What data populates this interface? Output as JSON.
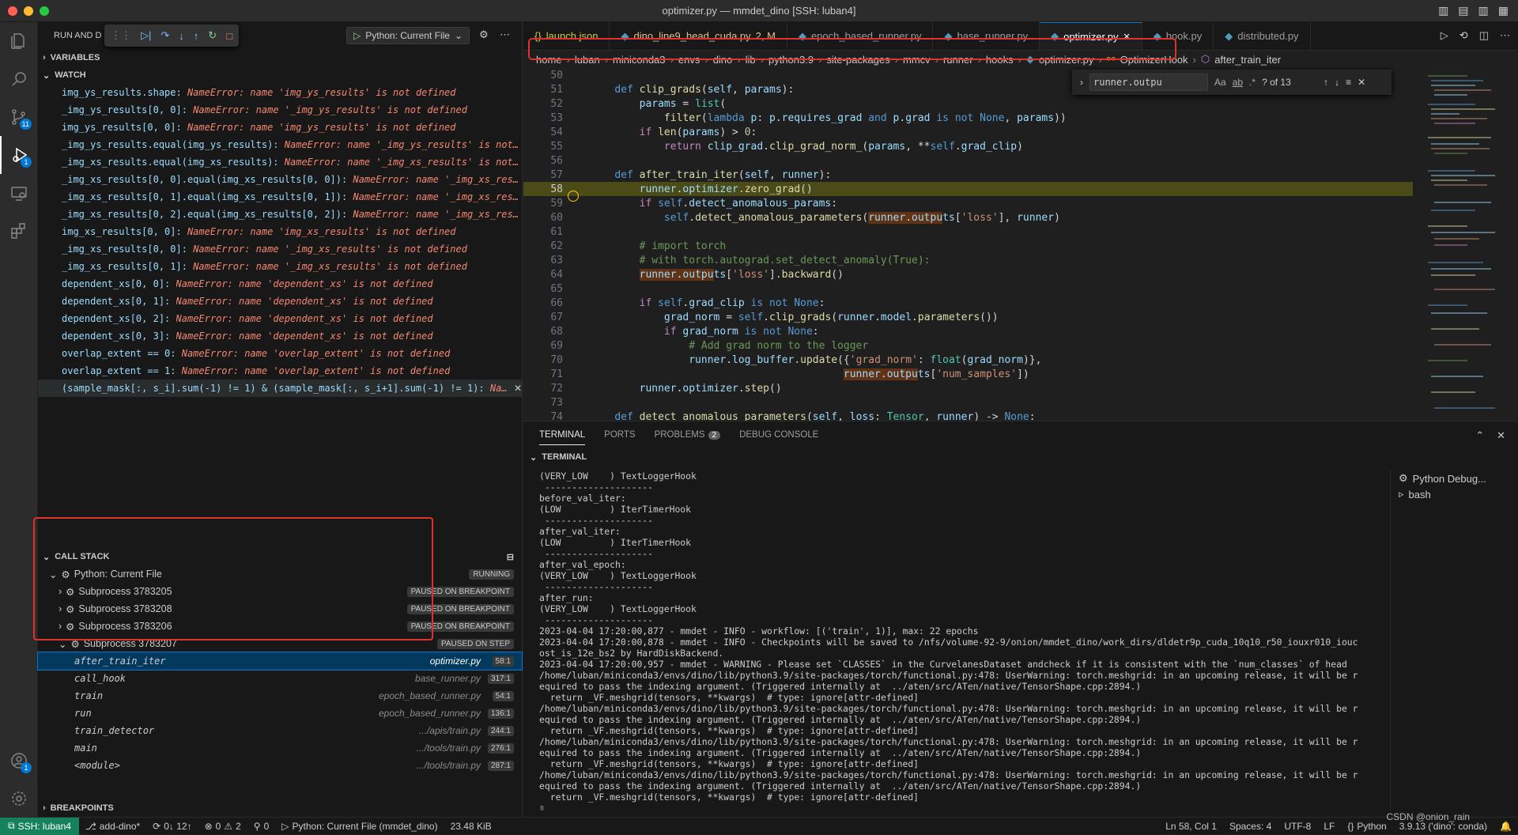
{
  "window": {
    "title": "optimizer.py — mmdet_dino [SSH: luban4]"
  },
  "activity_bar": {
    "badge_scm": "11",
    "badge_debug": "1",
    "badge_account": "1"
  },
  "run_panel": {
    "header": "RUN AND D",
    "config_label": "Python: Current File",
    "variables_label": "VARIABLES",
    "watch_label": "WATCH",
    "watch": [
      {
        "expr": "img_ys_results.shape:",
        "val": "NameError: name 'img_ys_results' is not defined"
      },
      {
        "expr": "_img_ys_results[0, 0]:",
        "val": "NameError: name '_img_ys_results' is not defined"
      },
      {
        "expr": "img_ys_results[0, 0]:",
        "val": "NameError: name 'img_ys_results' is not defined"
      },
      {
        "expr": "_img_ys_results.equal(img_ys_results):",
        "val": "NameError: name '_img_ys_results' is not defined"
      },
      {
        "expr": "_img_xs_results.equal(img_xs_results):",
        "val": "NameError: name '_img_xs_results' is not defined"
      },
      {
        "expr": "_img_xs_results[0, 0].equal(img_xs_results[0, 0]):",
        "val": "NameError: name '_img_xs_results' is..."
      },
      {
        "expr": "_img_xs_results[0, 1].equal(img_xs_results[0, 1]):",
        "val": "NameError: name '_img_xs_results' is..."
      },
      {
        "expr": "_img_xs_results[0, 2].equal(img_xs_results[0, 2]):",
        "val": "NameError: name '_img_xs_results' is..."
      },
      {
        "expr": "img_xs_results[0, 0]:",
        "val": "NameError: name 'img_xs_results' is not defined"
      },
      {
        "expr": "_img_xs_results[0, 0]:",
        "val": "NameError: name '_img_xs_results' is not defined"
      },
      {
        "expr": "_img_xs_results[0, 1]:",
        "val": "NameError: name '_img_xs_results' is not defined"
      },
      {
        "expr": "dependent_xs[0, 0]:",
        "val": "NameError: name 'dependent_xs' is not defined"
      },
      {
        "expr": "dependent_xs[0, 1]:",
        "val": "NameError: name 'dependent_xs' is not defined"
      },
      {
        "expr": "dependent_xs[0, 2]:",
        "val": "NameError: name 'dependent_xs' is not defined"
      },
      {
        "expr": "dependent_xs[0, 3]:",
        "val": "NameError: name 'dependent_xs' is not defined"
      },
      {
        "expr": "overlap_extent == 0:",
        "val": "NameError: name 'overlap_extent' is not defined"
      },
      {
        "expr": "overlap_extent == 1:",
        "val": "NameError: name 'overlap_extent' is not defined"
      },
      {
        "expr": "(sample_mask[:, s_i].sum(-1) != 1) & (sample_mask[:, s_i+1].sum(-1) != 1):",
        "val": "NameErro..."
      }
    ],
    "call_stack_label": "CALL STACK",
    "root_session": {
      "label": "Python: Current File",
      "status": "RUNNING"
    },
    "subprocesses": [
      {
        "label": "Subprocess 3783205",
        "status": "PAUSED ON BREAKPOINT"
      },
      {
        "label": "Subprocess 3783208",
        "status": "PAUSED ON BREAKPOINT"
      },
      {
        "label": "Subprocess 3783206",
        "status": "PAUSED ON BREAKPOINT"
      },
      {
        "label": "Subprocess 3783207",
        "status": "PAUSED ON STEP"
      }
    ],
    "frames": [
      {
        "fn": "after_train_iter",
        "file": "optimizer.py",
        "line": "58:1"
      },
      {
        "fn": "call_hook",
        "file": "base_runner.py",
        "line": "317:1"
      },
      {
        "fn": "train",
        "file": "epoch_based_runner.py",
        "line": "54:1"
      },
      {
        "fn": "run",
        "file": "epoch_based_runner.py",
        "line": "136:1"
      },
      {
        "fn": "train_detector",
        "file": ".../apis/train.py",
        "line": "244:1"
      },
      {
        "fn": "main",
        "file": ".../tools/train.py",
        "line": "276:1"
      },
      {
        "fn": "<module>",
        "file": ".../tools/train.py",
        "line": "287:1"
      }
    ],
    "breakpoints_label": "BREAKPOINTS"
  },
  "editor": {
    "tabs": [
      {
        "label": "launch.json",
        "icon": "{}",
        "color": "#cbcb41"
      },
      {
        "label": "dino_line9_head_cuda.py",
        "extra": "2, M",
        "color": "#e2c08d"
      },
      {
        "label": "epoch_based_runner.py",
        "color": "#9d9d9d"
      },
      {
        "label": "base_runner.py",
        "color": "#9d9d9d"
      },
      {
        "label": "optimizer.py",
        "color": "#ffffff",
        "active": true
      },
      {
        "label": "hook.py",
        "color": "#9d9d9d"
      },
      {
        "label": "distributed.py",
        "color": "#9d9d9d"
      }
    ],
    "breadcrumbs": [
      "home",
      "luban",
      "miniconda3",
      "envs",
      "dino",
      "lib",
      "python3.9",
      "site-packages",
      "mmcv",
      "runner",
      "hooks",
      "optimizer.py",
      "OptimizerHook",
      "after_train_iter"
    ],
    "find": {
      "value": "runner.outpu",
      "result": "? of 13",
      "aa": "Aa",
      "ab": "ab",
      "rx": ".*"
    }
  },
  "panel": {
    "tabs": [
      "TERMINAL",
      "PORTS",
      "PROBLEMS",
      "DEBUG CONSOLE"
    ],
    "problems_count": "2",
    "terminal_label": "TERMINAL",
    "terminals": [
      "Python Debug...",
      "bash"
    ],
    "lines": [
      "(VERY_LOW    ) TextLoggerHook",
      " -------------------- ",
      "before_val_iter:",
      "(LOW         ) IterTimerHook",
      " -------------------- ",
      "after_val_iter:",
      "(LOW         ) IterTimerHook",
      " -------------------- ",
      "after_val_epoch:",
      "(VERY_LOW    ) TextLoggerHook",
      " -------------------- ",
      "after_run:",
      "(VERY_LOW    ) TextLoggerHook",
      " -------------------- ",
      "2023-04-04 17:20:00,877 - mmdet - INFO - workflow: [('train', 1)], max: 22 epochs",
      "2023-04-04 17:20:00,878 - mmdet - INFO - Checkpoints will be saved to /nfs/volume-92-9/onion/mmdet_dino/work_dirs/dldetr9p_cuda_10q10_r50_iouxr010_iouc",
      "ost_is_12e_bs2 by HardDiskBackend.",
      "2023-04-04 17:20:00,957 - mmdet - WARNING - Please set `CLASSES` in the CurvelanesDataset andcheck if it is consistent with the `num_classes` of head",
      "/home/luban/miniconda3/envs/dino/lib/python3.9/site-packages/torch/functional.py:478: UserWarning: torch.meshgrid: in an upcoming release, it will be r",
      "equired to pass the indexing argument. (Triggered internally at  ../aten/src/ATen/native/TensorShape.cpp:2894.)",
      "  return _VF.meshgrid(tensors, **kwargs)  # type: ignore[attr-defined]",
      "/home/luban/miniconda3/envs/dino/lib/python3.9/site-packages/torch/functional.py:478: UserWarning: torch.meshgrid: in an upcoming release, it will be r",
      "equired to pass the indexing argument. (Triggered internally at  ../aten/src/ATen/native/TensorShape.cpp:2894.)",
      "  return _VF.meshgrid(tensors, **kwargs)  # type: ignore[attr-defined]",
      "/home/luban/miniconda3/envs/dino/lib/python3.9/site-packages/torch/functional.py:478: UserWarning: torch.meshgrid: in an upcoming release, it will be r",
      "equired to pass the indexing argument. (Triggered internally at  ../aten/src/ATen/native/TensorShape.cpp:2894.)",
      "  return _VF.meshgrid(tensors, **kwargs)  # type: ignore[attr-defined]",
      "/home/luban/miniconda3/envs/dino/lib/python3.9/site-packages/torch/functional.py:478: UserWarning: torch.meshgrid: in an upcoming release, it will be r",
      "equired to pass the indexing argument. (Triggered internally at  ../aten/src/ATen/native/TensorShape.cpp:2894.)",
      "  return _VF.meshgrid(tensors, **kwargs)  # type: ignore[attr-defined]",
      "▯"
    ]
  },
  "statusbar": {
    "remote": "SSH: luban4",
    "branch": "add-dino*",
    "sync": "0↓ 12↑",
    "errors": "0",
    "warnings": "2",
    "ports": "0",
    "debug": "Python: Current File (mmdet_dino)",
    "size": "23.48 KiB",
    "position": "Ln 58, Col 1",
    "spaces": "Spaces: 4",
    "encoding": "UTF-8",
    "eol": "LF",
    "language": "Python",
    "interpreter": "3.9.13 ('dino': conda)",
    "watermark": "CSDN @onion_rain"
  }
}
